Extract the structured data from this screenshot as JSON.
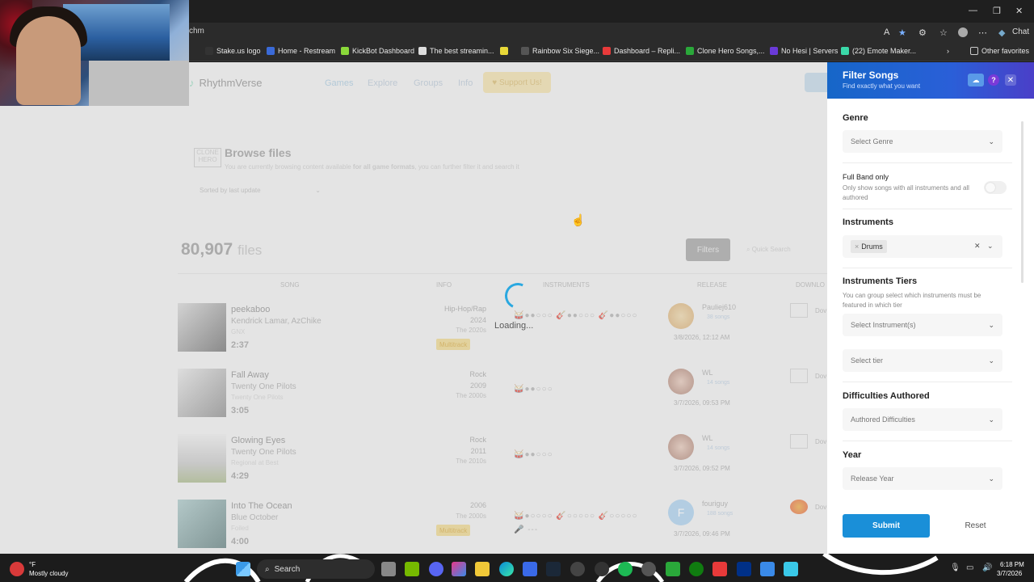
{
  "browser": {
    "url": "chm",
    "chat_label": "Chat",
    "bookmarks": [
      {
        "label": "Stake.us logo"
      },
      {
        "label": "Home - Restream"
      },
      {
        "label": "KickBot Dashboard"
      },
      {
        "label": "The best streamin..."
      },
      {
        "label": "Rainbow Six Siege..."
      },
      {
        "label": "Dashboard – Repli..."
      },
      {
        "label": "Clone Hero Songs,..."
      },
      {
        "label": "No Hesi | Servers"
      },
      {
        "label": "(22) Emote Maker..."
      },
      {
        "label": "Other favorites"
      }
    ]
  },
  "site": {
    "logo": "RhythmVerse",
    "nav": [
      "Games",
      "Explore",
      "Groups",
      "Info"
    ],
    "support": "Support Us!",
    "browse_icon": "CLONE HERO",
    "browse_title": "Browse files",
    "browse_sub_prefix": "You are currently browsing content available ",
    "browse_sub_bold": "for all game formats",
    "browse_sub_suffix": ", you can further filter it and search it",
    "sort": "Sorted by last update",
    "count": "80,907",
    "count_unit": "files",
    "filters_btn": "Filters",
    "quick_search": "Quick Search",
    "columns": [
      "SONG",
      "INFO",
      "INSTRUMENTS",
      "RELEASE",
      "DOWNLO"
    ],
    "rows": [
      {
        "title": "peekaboo",
        "artist": "Kendrick Lamar, AzChike",
        "album": "GNX",
        "length": "2:37",
        "genre": "Hip-Hop/Rap",
        "year": "2024",
        "decade": "The 2020s",
        "badge": "Multitrack",
        "instruments": "🥁●●○○○ 🎸●●○○○ 🎸●●○○○",
        "uploader": "Pauliej610",
        "songs": "38 songs",
        "date": "3/8/2026, 12:12 AM",
        "dl": "Dov"
      },
      {
        "title": "Fall Away",
        "artist": "Twenty One Pilots",
        "album": "Twenty One Pilots",
        "length": "3:05",
        "genre": "Rock",
        "year": "2009",
        "decade": "The 2000s",
        "badge": "",
        "instruments": "🥁●●○○○",
        "uploader": "WL",
        "songs": "14 songs",
        "date": "3/7/2026, 09:53 PM",
        "dl": "Dov"
      },
      {
        "title": "Glowing Eyes",
        "artist": "Twenty One Pilots",
        "album": "Regional at Best",
        "length": "4:29",
        "genre": "Rock",
        "year": "2011",
        "decade": "The 2010s",
        "badge": "",
        "instruments": "🥁●●○○○",
        "uploader": "WL",
        "songs": "14 songs",
        "date": "3/7/2026, 09:52 PM",
        "dl": "Dov"
      },
      {
        "title": "Into The Ocean",
        "artist": "Blue October",
        "album": "Foiled",
        "length": "4:00",
        "genre": "",
        "year": "2006",
        "decade": "The 2000s",
        "badge": "Multitrack",
        "instruments": "🥁●○○○○ 🎸○○○○○ 🎸○○○○○ 🎤 ---",
        "uploader": "fouriguy",
        "songs": "188 songs",
        "date": "3/7/2026, 09:46 PM",
        "dl": "Dov"
      }
    ],
    "loading": "Loading..."
  },
  "filter_panel": {
    "title": "Filter Songs",
    "subtitle": "Find exactly what you want",
    "genre_title": "Genre",
    "genre_placeholder": "Select Genre",
    "fullband_label": "Full Band only",
    "fullband_desc": "Only show songs with all instruments and all authored",
    "fullband_on": false,
    "instruments_title": "Instruments",
    "instrument_tag": "Drums",
    "tiers_title": "Instruments Tiers",
    "tiers_desc": "You can group select which instruments must be featured in which tier",
    "tier_instrument_placeholder": "Select Instrument(s)",
    "tier_placeholder": "Select tier",
    "difficulties_title": "Difficulties Authored",
    "difficulties_placeholder": "Authored Difficulties",
    "year_title": "Year",
    "year_placeholder": "Release Year",
    "submit": "Submit",
    "reset": "Reset"
  },
  "taskbar": {
    "temp": "°F",
    "weather": "Mostly cloudy",
    "search": "Search",
    "time": "6:18 PM",
    "date": "3/7/2026"
  },
  "colors": {
    "accent": "#1a8fd8",
    "panel_header": "#1666c8"
  }
}
